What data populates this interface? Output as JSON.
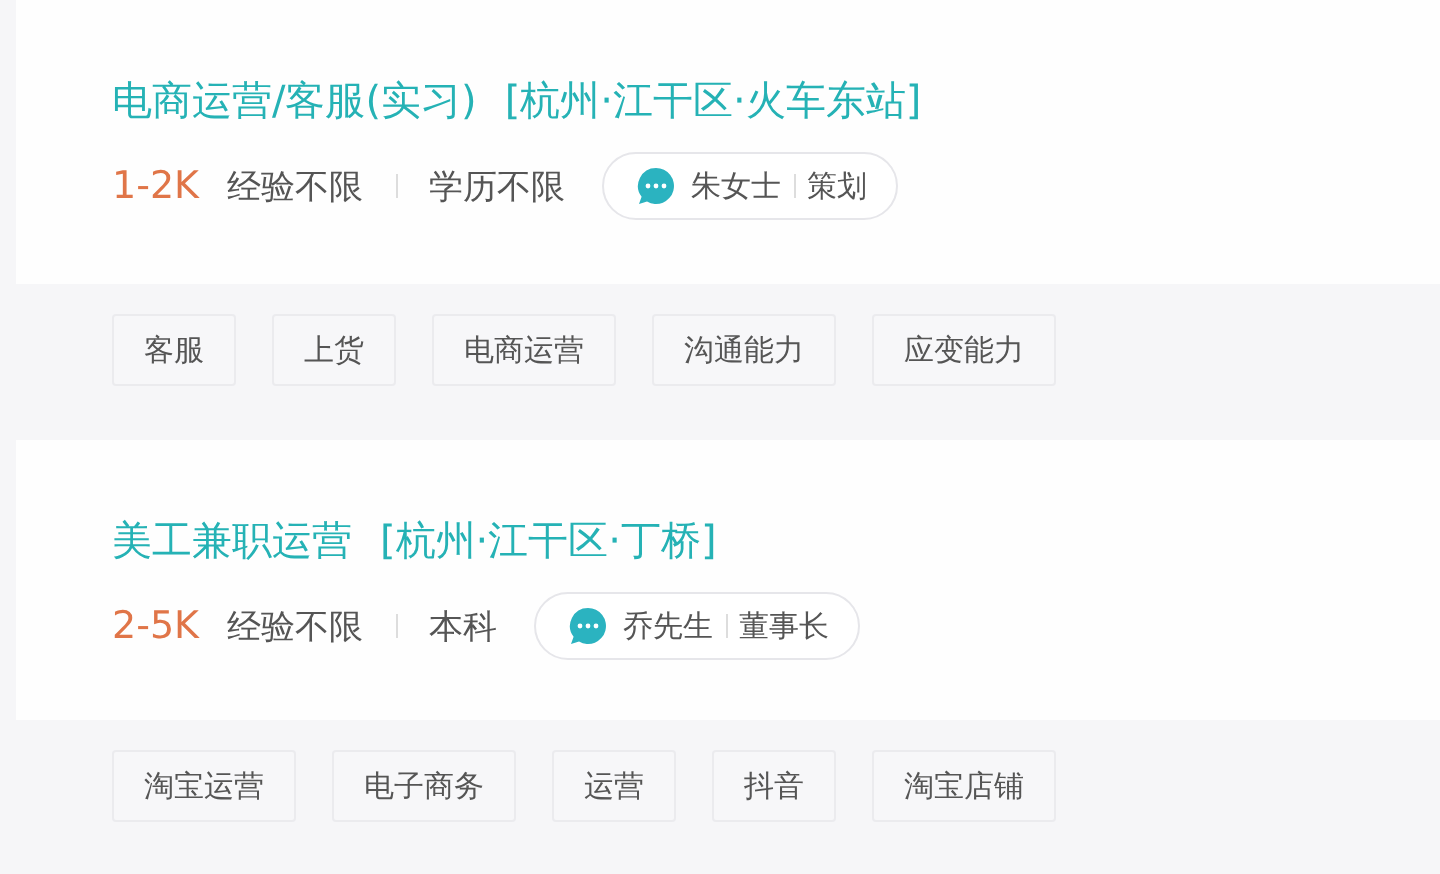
{
  "jobs": [
    {
      "title": "电商运营/客服(实习)",
      "location": "[杭州·江干区·火车东站]",
      "salary": "1-2K",
      "experience": "经验不限",
      "education": "学历不限",
      "contact": {
        "name": "朱女士",
        "role": "策划"
      },
      "tags": [
        "客服",
        "上货",
        "电商运营",
        "沟通能力",
        "应变能力"
      ]
    },
    {
      "title": "美工兼职运营",
      "location": "[杭州·江干区·丁桥]",
      "salary": "2-5K",
      "experience": "经验不限",
      "education": "本科",
      "contact": {
        "name": "乔先生",
        "role": "董事长"
      },
      "tags": [
        "淘宝运营",
        "电子商务",
        "运营",
        "抖音",
        "淘宝店铺"
      ]
    }
  ]
}
